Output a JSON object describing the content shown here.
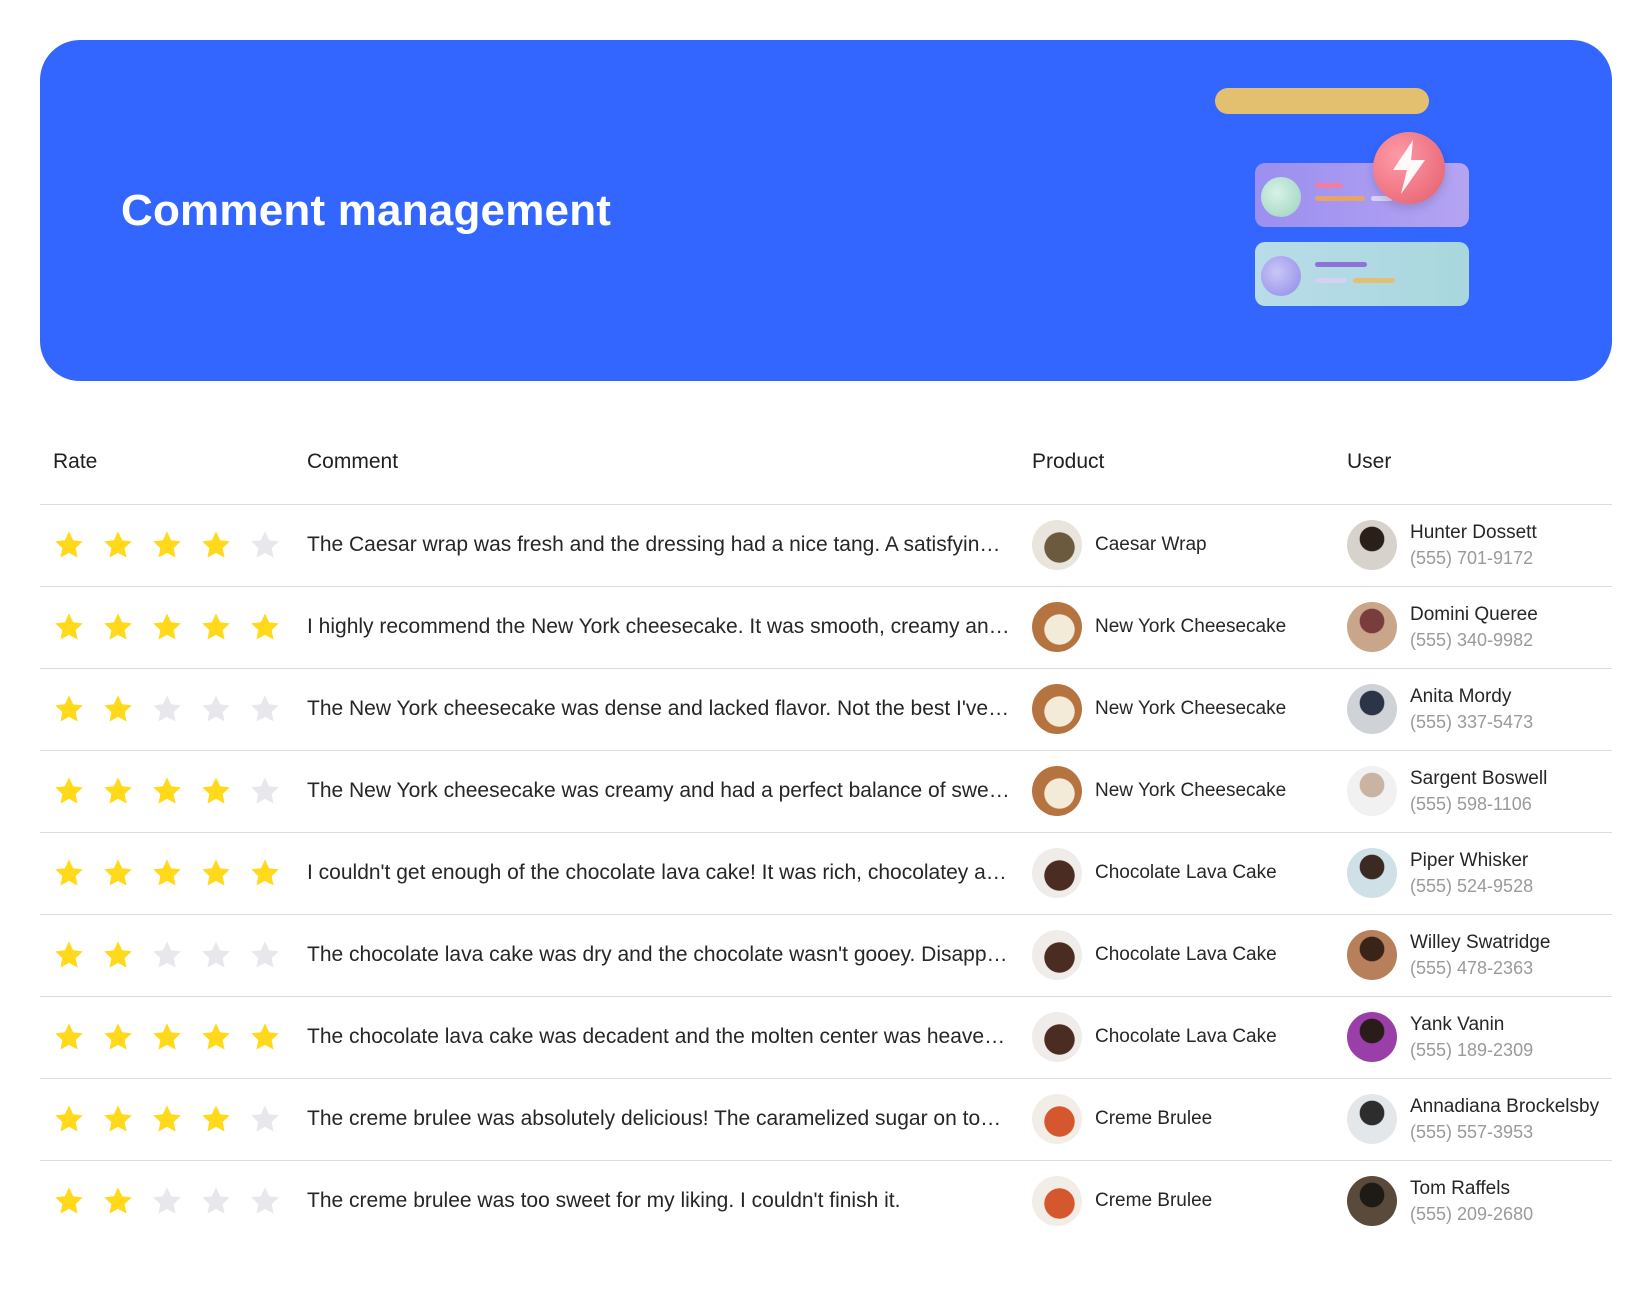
{
  "header": {
    "title": "Comment management",
    "background_color": "#3366ff",
    "illustration": "dashboard-cards-illustration"
  },
  "table": {
    "columns": {
      "rate": "Rate",
      "comment": "Comment",
      "product": "Product",
      "user": "User"
    },
    "max_rating": 5,
    "rows": [
      {
        "rating": 4,
        "comment": "The Caesar wrap was fresh and the dressing had a nice tang. A satisfying lunch.",
        "product": {
          "name": "Caesar Wrap",
          "thumb_colors": [
            "#e9e4dc",
            "#6b5a3e"
          ]
        },
        "user": {
          "name": "Hunter Dossett",
          "phone": "(555) 701-9172",
          "avatar_colors": [
            "#d8d2cc",
            "#2b1f1a"
          ]
        }
      },
      {
        "rating": 5,
        "comment": "I highly recommend the New York cheesecake. It was smooth, creamy and delicious.",
        "product": {
          "name": "New York Cheesecake",
          "thumb_colors": [
            "#b5743f",
            "#f3ead7"
          ]
        },
        "user": {
          "name": "Domini Queree",
          "phone": "(555) 340-9982",
          "avatar_colors": [
            "#c9a58a",
            "#7a3d3d"
          ]
        }
      },
      {
        "rating": 2,
        "comment": "The New York cheesecake was dense and lacked flavor. Not the best I've had.",
        "product": {
          "name": "New York Cheesecake",
          "thumb_colors": [
            "#b5743f",
            "#f3ead7"
          ]
        },
        "user": {
          "name": "Anita Mordy",
          "phone": "(555) 337-5473",
          "avatar_colors": [
            "#cfd3d8",
            "#2c3447"
          ]
        }
      },
      {
        "rating": 4,
        "comment": "The New York cheesecake was creamy and had a perfect balance of sweetness.",
        "product": {
          "name": "New York Cheesecake",
          "thumb_colors": [
            "#b5743f",
            "#f3ead7"
          ]
        },
        "user": {
          "name": "Sargent Boswell",
          "phone": "(555) 598-1106",
          "avatar_colors": [
            "#f1f1f1",
            "#c9b3a3"
          ]
        }
      },
      {
        "rating": 5,
        "comment": "I couldn't get enough of the chocolate lava cake! It was rich, chocolatey and amazing.",
        "product": {
          "name": "Chocolate Lava Cake",
          "thumb_colors": [
            "#efece9",
            "#4a2c22"
          ]
        },
        "user": {
          "name": "Piper Whisker",
          "phone": "(555) 524-9528",
          "avatar_colors": [
            "#cfe0e6",
            "#3b2a22"
          ]
        }
      },
      {
        "rating": 2,
        "comment": "The chocolate lava cake was dry and the chocolate wasn't gooey. Disappointing.",
        "product": {
          "name": "Chocolate Lava Cake",
          "thumb_colors": [
            "#efece9",
            "#4a2c22"
          ]
        },
        "user": {
          "name": "Willey Swatridge",
          "phone": "(555) 478-2363",
          "avatar_colors": [
            "#b7805a",
            "#3a2418"
          ]
        }
      },
      {
        "rating": 5,
        "comment": "The chocolate lava cake was decadent and the molten center was heavenly.",
        "product": {
          "name": "Chocolate Lava Cake",
          "thumb_colors": [
            "#efece9",
            "#4a2c22"
          ]
        },
        "user": {
          "name": "Yank Vanin",
          "phone": "(555) 189-2309",
          "avatar_colors": [
            "#9a3fa8",
            "#2a1c18"
          ]
        }
      },
      {
        "rating": 4,
        "comment": "The creme brulee was absolutely delicious! The caramelized sugar on top was perfect.",
        "product": {
          "name": "Creme Brulee",
          "thumb_colors": [
            "#f2ede6",
            "#d4572d"
          ]
        },
        "user": {
          "name": "Annadiana Brockelsby",
          "phone": "(555) 557-3953",
          "avatar_colors": [
            "#e4e7ea",
            "#2d2d2d"
          ]
        }
      },
      {
        "rating": 2,
        "comment": "The creme brulee was too sweet for my liking. I couldn't finish it.",
        "product": {
          "name": "Creme Brulee",
          "thumb_colors": [
            "#f2ede6",
            "#d4572d"
          ]
        },
        "user": {
          "name": "Tom Raffels",
          "phone": "(555) 209-2680",
          "avatar_colors": [
            "#5a4a3c",
            "#1e1a16"
          ]
        }
      }
    ]
  },
  "colors": {
    "star_on": "#ffd91a",
    "star_off": "#e8e8ec",
    "divider": "#dcdcdc",
    "phone_text": "#9a9a9a"
  }
}
